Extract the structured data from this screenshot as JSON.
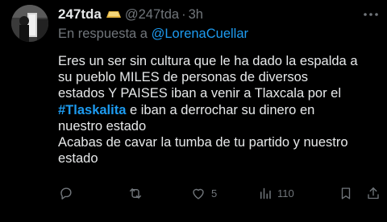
{
  "tweet": {
    "display_name": "247tda",
    "handle": "@247tda",
    "separator": "·",
    "time": "3h",
    "reply_prefix": "En respuesta a",
    "reply_mention": "@LorenaCuellar",
    "body": {
      "line1": "Eres un ser sin cultura que le ha dado la espalda a",
      "line2": "su pueblo MILES de personas de diversos",
      "line3": "estados Y PAISES iban a venir a Tlaxcala por el",
      "hashtag": "#Tlaskalita",
      "line4_rest": " e iban a derrochar su dinero en",
      "line5": "nuestro estado",
      "line6": "Acabas de cavar la tumba de tu partido y  nuestro",
      "line7": "estado"
    },
    "actions": {
      "reply_count": "",
      "retweet_count": "",
      "like_count": "5",
      "views_count": "110"
    }
  },
  "colors": {
    "background": "#000000",
    "text": "#e7e9ea",
    "secondary": "#71767b",
    "accent": "#1d9bf0",
    "badge": "#e2b340"
  },
  "icons": [
    "gold-bar-badge-icon",
    "more-icon",
    "reply-icon",
    "retweet-icon",
    "like-icon",
    "views-icon",
    "bookmark-icon",
    "share-icon"
  ]
}
